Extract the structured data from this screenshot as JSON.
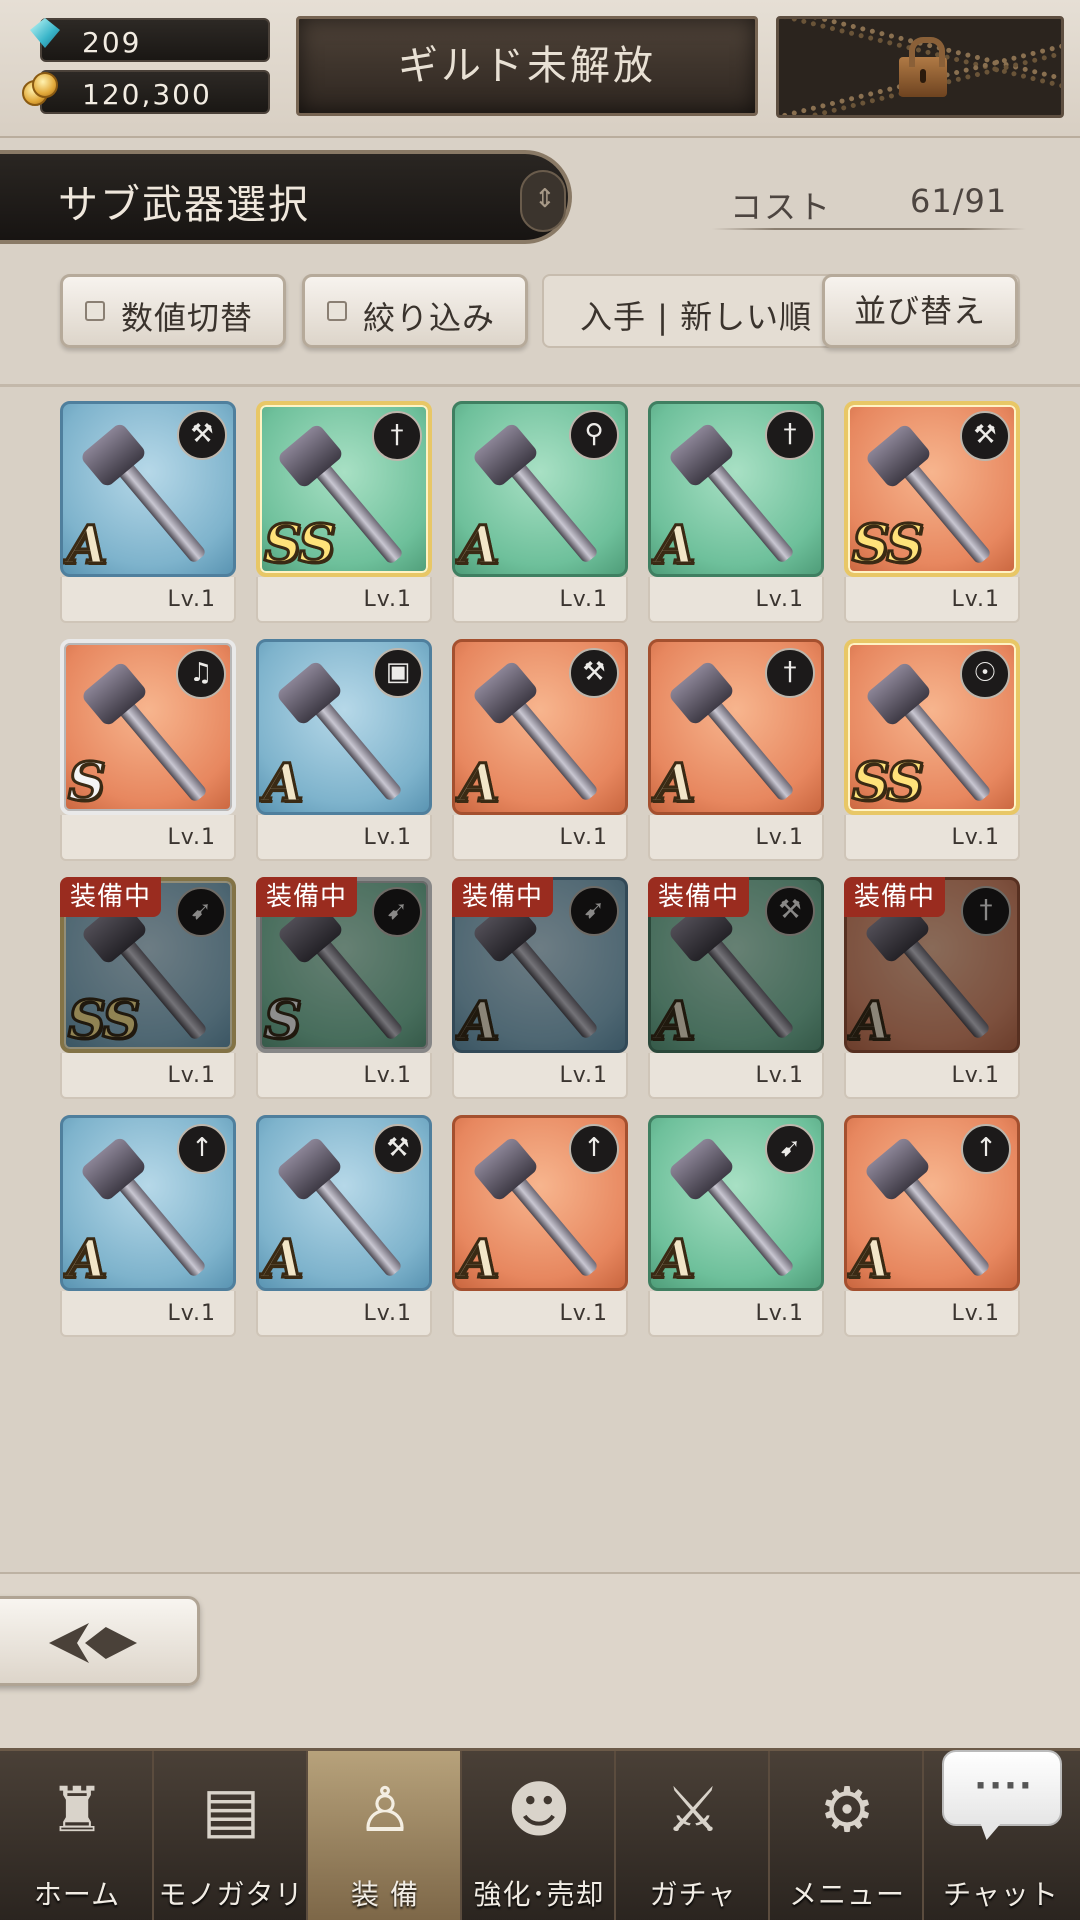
{
  "currency": {
    "gems": "209",
    "coins": "120,300"
  },
  "guild": {
    "label": "ギルド未解放"
  },
  "header": {
    "title": "サブ武器選択",
    "cost_label": "コスト",
    "cost_value": "61/91"
  },
  "filters": {
    "toggle_label": "数値切替",
    "filter_label": "絞り込み",
    "sort_text": "入手 | 新しい順",
    "sort_button": "並び替え"
  },
  "weapons": [
    {
      "rank": "A",
      "level": "Lv.1",
      "color": "#7eb3cc",
      "type_icon": "hammer-icon",
      "equipped": false
    },
    {
      "rank": "SS",
      "level": "Lv.1",
      "color": "#6ec09b",
      "type_icon": "sword-icon",
      "equipped": false
    },
    {
      "rank": "A",
      "level": "Lv.1",
      "color": "#6ec09b",
      "type_icon": "staff-icon",
      "equipped": false
    },
    {
      "rank": "A",
      "level": "Lv.1",
      "color": "#6ec09b",
      "type_icon": "sword-icon",
      "equipped": false
    },
    {
      "rank": "SS",
      "level": "Lv.1",
      "color": "#e7875f",
      "type_icon": "hammer-icon",
      "equipped": false
    },
    {
      "rank": "S",
      "level": "Lv.1",
      "color": "#e7875f",
      "type_icon": "harp-icon",
      "equipped": false
    },
    {
      "rank": "A",
      "level": "Lv.1",
      "color": "#7eb3cc",
      "type_icon": "book-icon",
      "equipped": false
    },
    {
      "rank": "A",
      "level": "Lv.1",
      "color": "#e7875f",
      "type_icon": "hammer-icon",
      "equipped": false
    },
    {
      "rank": "A",
      "level": "Lv.1",
      "color": "#e7875f",
      "type_icon": "sword-icon",
      "equipped": false
    },
    {
      "rank": "SS",
      "level": "Lv.1",
      "color": "#e7875f",
      "type_icon": "puppet-icon",
      "equipped": false
    },
    {
      "rank": "SS",
      "level": "Lv.1",
      "color": "#7eb3cc",
      "type_icon": "bow-icon",
      "equipped": true
    },
    {
      "rank": "S",
      "level": "Lv.1",
      "color": "#6ec09b",
      "type_icon": "bow-icon",
      "equipped": true
    },
    {
      "rank": "A",
      "level": "Lv.1",
      "color": "#7eb3cc",
      "type_icon": "bow-icon",
      "equipped": true
    },
    {
      "rank": "A",
      "level": "Lv.1",
      "color": "#6ec09b",
      "type_icon": "hammer-icon",
      "equipped": true
    },
    {
      "rank": "A",
      "level": "Lv.1",
      "color": "#e7875f",
      "type_icon": "sword-icon",
      "equipped": true
    },
    {
      "rank": "A",
      "level": "Lv.1",
      "color": "#7eb3cc",
      "type_icon": "spear-icon",
      "equipped": false
    },
    {
      "rank": "A",
      "level": "Lv.1",
      "color": "#7eb3cc",
      "type_icon": "hammer-icon",
      "equipped": false
    },
    {
      "rank": "A",
      "level": "Lv.1",
      "color": "#e7875f",
      "type_icon": "spear-icon",
      "equipped": false
    },
    {
      "rank": "A",
      "level": "Lv.1",
      "color": "#6ec09b",
      "type_icon": "bow-icon",
      "equipped": false
    },
    {
      "rank": "A",
      "level": "Lv.1",
      "color": "#e7875f",
      "type_icon": "spear-icon",
      "equipped": false
    }
  ],
  "equipped_label": "装備中",
  "nav": {
    "home": "ホーム",
    "story": "モノガタリ",
    "equip": "装 備",
    "enhance": "強化･売却",
    "gacha": "ガチャ",
    "menu": "メニュー",
    "chat": "チャット"
  },
  "colors": {
    "accent": "#9a2c1f",
    "nav_active": "#b7a27b"
  }
}
